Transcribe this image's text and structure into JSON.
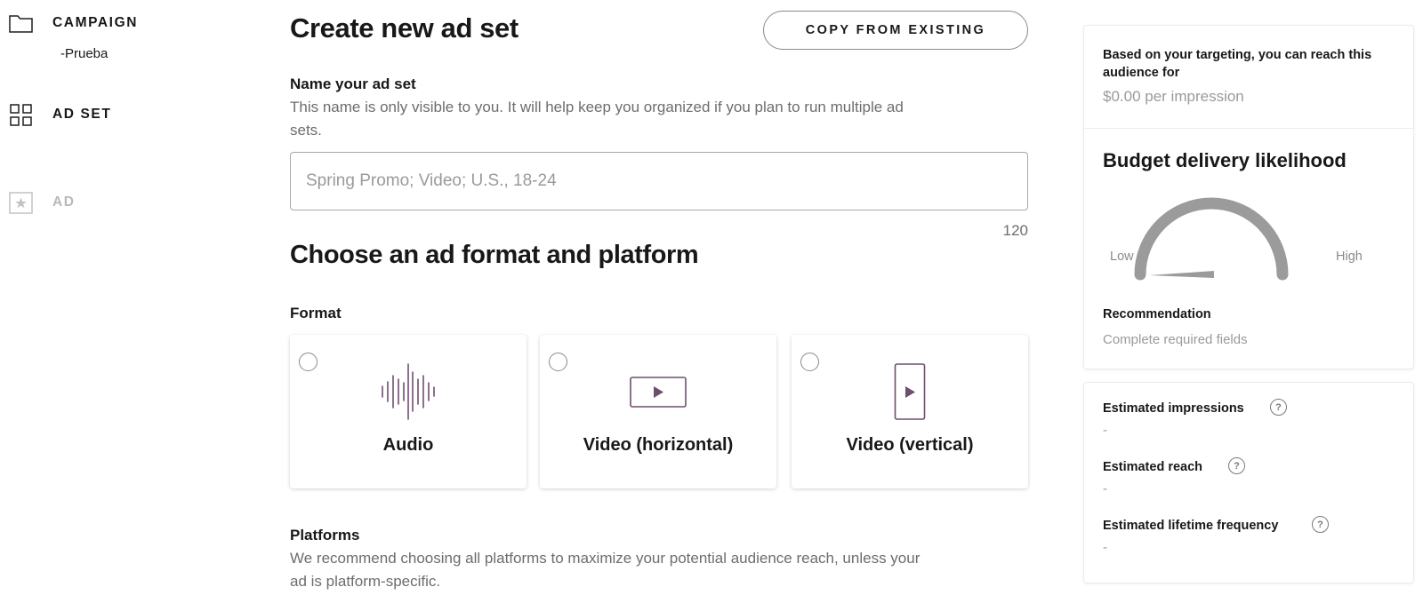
{
  "nav": {
    "campaign_label": "CAMPAIGN",
    "campaign_name": "-Prueba",
    "adset_label": "AD SET",
    "ad_label": "AD",
    "icons": [
      "folder-icon",
      "grid-icon",
      "star-icon"
    ]
  },
  "main": {
    "title": "Create new ad set",
    "copy_button": "COPY FROM EXISTING",
    "name_label": "Name your ad set",
    "name_help": "This name is only visible to you. It will help keep you organized if you plan to run multiple ad sets.",
    "name_value": "",
    "name_placeholder": "Spring Promo; Video; U.S., 18-24",
    "char_count": "120",
    "section_title": "Choose an ad format and platform",
    "format_label": "Format",
    "formats": [
      {
        "label": "Audio",
        "icon": "audio-waveform-icon",
        "selected": false
      },
      {
        "label": "Video (horizontal)",
        "icon": "video-horizontal-icon",
        "selected": false
      },
      {
        "label": "Video (vertical)",
        "icon": "video-vertical-icon",
        "selected": false
      }
    ],
    "platforms_label": "Platforms",
    "platforms_help": "We recommend choosing all platforms to maximize your potential audience reach, unless your ad is platform-specific."
  },
  "panel": {
    "reach_text": "Based on your targeting, you can reach this audience for",
    "reach_price": "$0.00 per impression",
    "budget_title": "Budget delivery likelihood",
    "gauge_low": "Low",
    "gauge_high": "High",
    "gauge_level": 0,
    "recommendation_label": "Recommendation",
    "recommendation_value": "Complete required fields",
    "stats": [
      {
        "label": "Estimated impressions",
        "value": "-"
      },
      {
        "label": "Estimated reach",
        "value": "-"
      },
      {
        "label": "Estimated lifetime frequency",
        "value": "-"
      }
    ]
  },
  "colors": {
    "accent_purple": "#6e4f6d",
    "gauge_gray": "#9b9b9b",
    "muted_text": "#9a9a9a",
    "body_text": "#181818"
  }
}
